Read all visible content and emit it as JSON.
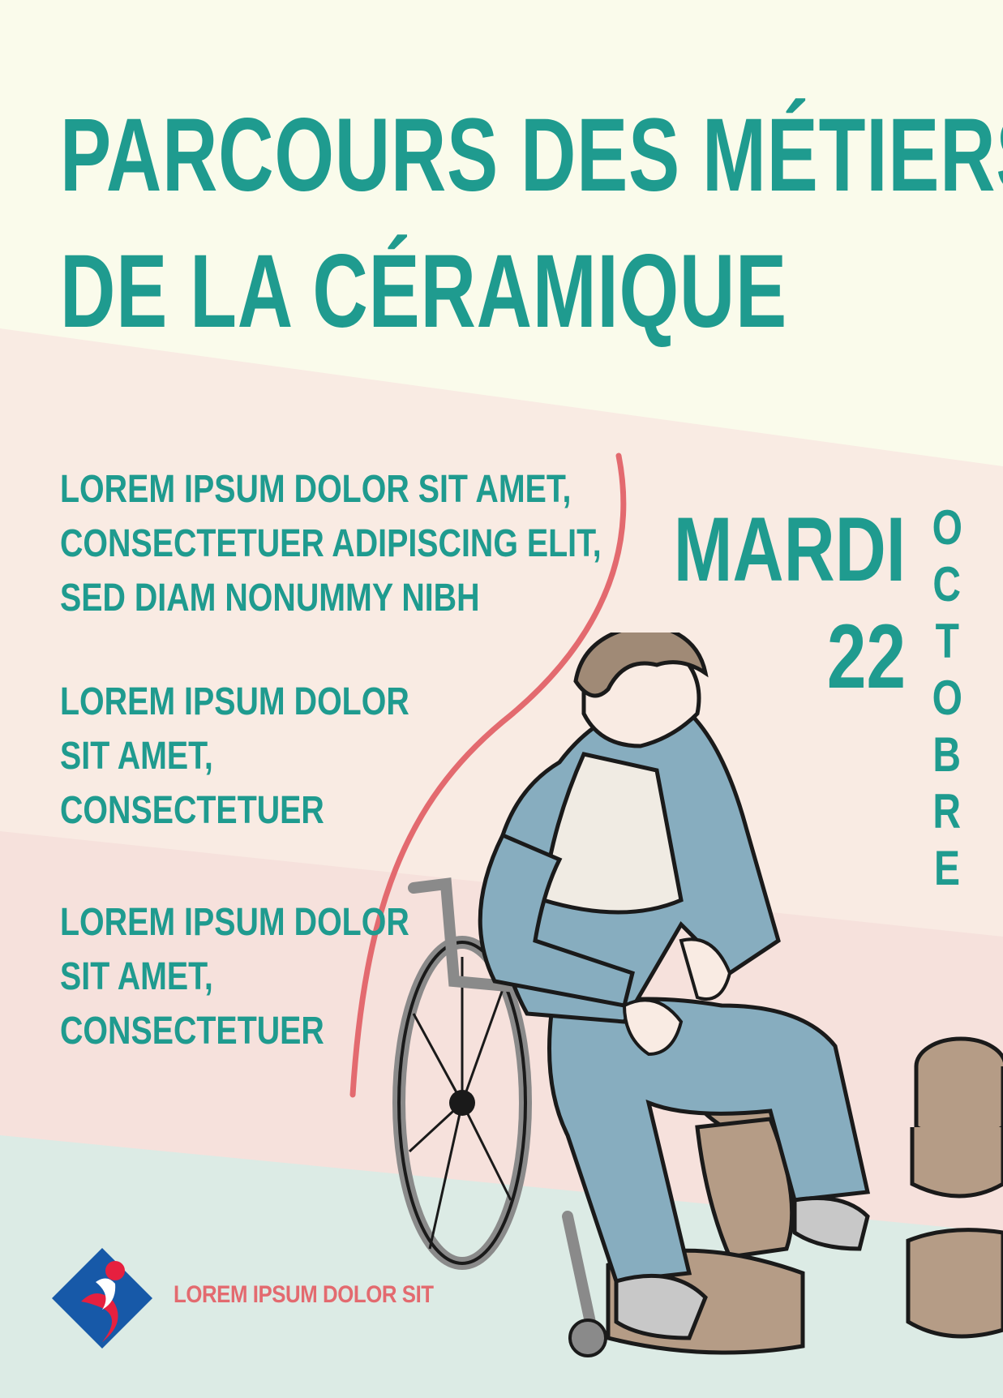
{
  "poster": {
    "title_lines": [
      "PARCOURS DES MÉTIERS",
      "DE LA CÉRAMIQUE"
    ],
    "block1": [
      "LOREM IPSUM DOLOR SIT AMET,",
      "CONSECTETUER ADIPISCING ELIT,",
      "SED DIAM NONUMMY NIBH"
    ],
    "block2": [
      "LOREM IPSUM DOLOR",
      "SIT AMET,",
      "CONSECTETUER"
    ],
    "block3": [
      "LOREM IPSUM DOLOR",
      "SIT AMET,",
      "CONSECTETUER"
    ],
    "day_name": "MARDI",
    "day_number": "22",
    "month_letters": [
      "O",
      "C",
      "T",
      "O",
      "B",
      "R",
      "E"
    ],
    "footer_text": "LOREM IPSUM DOLOR SIT"
  },
  "colors": {
    "background_top": "#fafbeb",
    "band_light_pink": "#f9ebe3",
    "band_pink": "#f6e1dc",
    "band_mint": "#dcebe5",
    "accent_teal": "#1f9b8f",
    "accent_coral": "#e36a6f",
    "logo_blue": "#1759a8",
    "logo_red": "#e6203f"
  },
  "icons": {
    "logo": "diamond-person-logo-icon",
    "illustration": "potter-in-wheelchair-illustration"
  }
}
